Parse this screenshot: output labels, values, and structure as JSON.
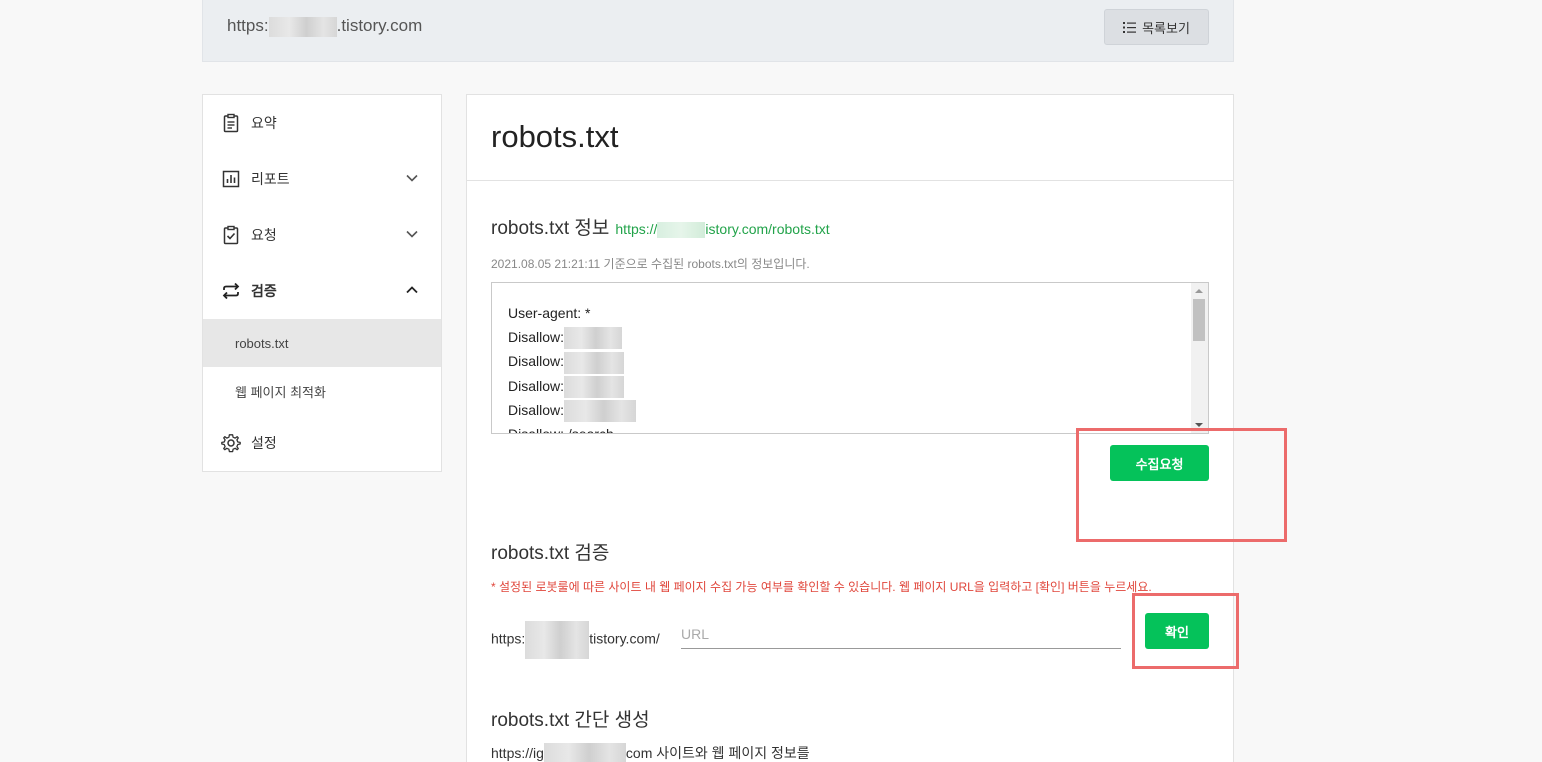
{
  "header": {
    "url_prefix": "https:",
    "url_suffix": ".tistory.com",
    "list_button_label": "목록보기"
  },
  "sidebar": {
    "items": [
      {
        "label": "요약",
        "icon": "clipboard-icon"
      },
      {
        "label": "리포트",
        "icon": "chart-icon"
      },
      {
        "label": "요청",
        "icon": "checklist-icon"
      },
      {
        "label": "검증",
        "icon": "swap-icon"
      },
      {
        "label": "설정",
        "icon": "gear-icon"
      }
    ],
    "sub_items": [
      {
        "label": "robots.txt"
      },
      {
        "label": "웹 페이지 최적화"
      }
    ]
  },
  "main": {
    "title": "robots.txt",
    "info": {
      "title": "robots.txt 정보",
      "link_prefix": "https://",
      "link_suffix": "istory.com/robots.txt",
      "note": "2021.08.05 21:21:11 기준으로 수집된 robots.txt의 정보입니다.",
      "lines": [
        "User-agent: *",
        "Disallow:",
        "Disallow:",
        "Disallow:",
        "Disallow:",
        "Disallow: /search"
      ],
      "collect_button": "수집요청"
    },
    "verify": {
      "title": "robots.txt 검증",
      "warning": "* 설정된 로봇룰에 따른 사이트 내 웹 페이지 수집 가능 여부를 확인할 수 있습니다. 웹 페이지 URL을 입력하고 [확인] 버튼을 누르세요.",
      "url_prefix_a": "https:",
      "url_prefix_b": "tistory.com/",
      "placeholder": "URL",
      "confirm_button": "확인"
    },
    "generate": {
      "title": "robots.txt 간단 생성",
      "desc_a": "https://ig",
      "desc_b": "com 사이트와 웹 페이지 정보를"
    }
  },
  "colors": {
    "accent_green": "#05c25a",
    "link_green": "#22a34a",
    "warning_red": "#e0463b",
    "annotation_red": "#ec6b6b"
  }
}
